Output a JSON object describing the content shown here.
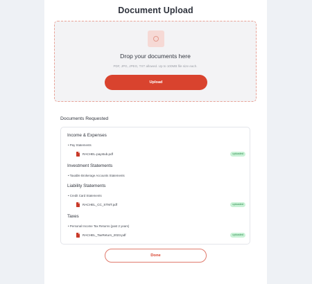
{
  "page": {
    "title": "Document Upload"
  },
  "dropzone": {
    "icon": "upload-icon",
    "title": "Drop your documents here",
    "subtitle": "PDF, JPG, JPEG, TXT allowed. Up to 100MB file size each.",
    "upload_label": "Upload"
  },
  "documents": {
    "heading": "Documents Requested",
    "sections": [
      {
        "title": "Income & Expenses",
        "items": [
          {
            "label": "• Pay Statements",
            "files": [
              {
                "name": "RACHEL-paystub.pdf",
                "status": "uploaded"
              }
            ]
          }
        ]
      },
      {
        "title": "Investment Statements",
        "items": [
          {
            "label": "• Taxable Brokerage Accounts Statements",
            "files": []
          }
        ]
      },
      {
        "title": "Liability Statements",
        "items": [
          {
            "label": "• Credit Card Statements",
            "files": [
              {
                "name": "RACHEL_CC_STMT.pdf",
                "status": "uploaded"
              }
            ]
          }
        ]
      },
      {
        "title": "Taxes",
        "items": [
          {
            "label": "• Personal Income Tax Returns (past 2 years)",
            "files": [
              {
                "name": "RACHEL_TaxReturn_2023.pdf",
                "status": "uploaded"
              }
            ]
          }
        ]
      }
    ]
  },
  "footer": {
    "done_label": "Done"
  },
  "colors": {
    "accent": "#d9432e",
    "badge_bg": "#c9f2d6",
    "badge_text": "#2e8a4f"
  }
}
